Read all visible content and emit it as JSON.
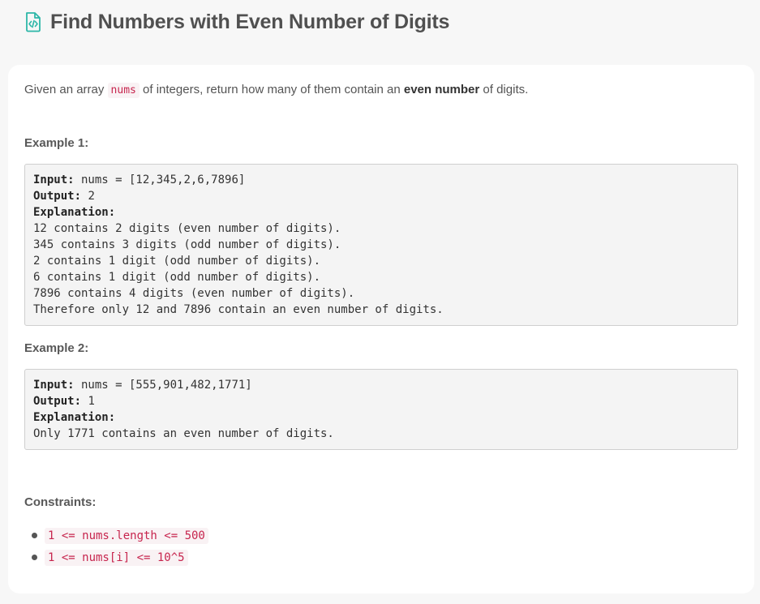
{
  "header": {
    "title": "Find Numbers with Even Number of Digits",
    "icon": "code-file-icon",
    "icon_color": "#2db7a8"
  },
  "intro": {
    "before": "Given an array ",
    "code": "nums",
    "middle": " of integers, return how many of them contain an ",
    "bold": "even number",
    "after": " of digits."
  },
  "examples": [
    {
      "heading": "Example 1:",
      "input_label": "Input:",
      "input_value": " nums = [12,345,2,6,7896]",
      "output_label": "Output:",
      "output_value": " 2",
      "explanation_label": "Explanation:",
      "explanation_lines": [
        "12 contains 2 digits (even number of digits).",
        "345 contains 3 digits (odd number of digits).",
        "2 contains 1 digit (odd number of digits).",
        "6 contains 1 digit (odd number of digits).",
        "7896 contains 4 digits (even number of digits).",
        "Therefore only 12 and 7896 contain an even number of digits."
      ]
    },
    {
      "heading": "Example 2:",
      "input_label": "Input:",
      "input_value": " nums = [555,901,482,1771]",
      "output_label": "Output:",
      "output_value": " 1",
      "explanation_label": "Explanation:",
      "explanation_lines": [
        "Only 1771 contains an even number of digits."
      ]
    }
  ],
  "constraints": {
    "heading": "Constraints:",
    "items": [
      "1 <= nums.length <= 500",
      "1 <= nums[i] <= 10^5"
    ]
  }
}
